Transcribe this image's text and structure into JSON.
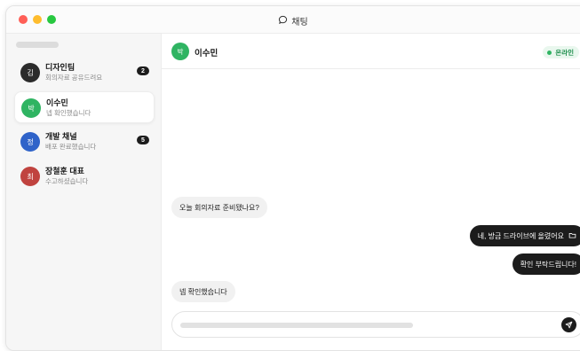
{
  "window": {
    "title": "채팅",
    "title_icon": "chat-bubble-icon"
  },
  "sidebar": {
    "conversations": [
      {
        "avatar": "김",
        "name": "디자인팀",
        "preview": "회의자료 공유드려요",
        "unread": "2",
        "avatar_color": "#2b2b2b",
        "active": false
      },
      {
        "avatar": "박",
        "name": "이수민",
        "preview": "넵 확인했습니다",
        "unread": "",
        "avatar_color": "#2fb462",
        "active": true
      },
      {
        "avatar": "정",
        "name": "개발 채널",
        "preview": "배포 완료했습니다",
        "unread": "5",
        "avatar_color": "#2f63c9",
        "active": false
      },
      {
        "avatar": "최",
        "name": "장철훈 대표",
        "preview": "수고하셨습니다",
        "unread": "",
        "avatar_color": "#c0433f",
        "active": false
      }
    ]
  },
  "chat": {
    "header": {
      "avatar": "박",
      "name": "이수민",
      "status": "온라인"
    },
    "messages": [
      {
        "direction": "in",
        "text": "오늘 회의자료 준비됐나요?"
      },
      {
        "direction": "out",
        "text": "네, 방금 드라이브에 올렸어요",
        "icon": "folder-icon"
      },
      {
        "direction": "out",
        "text": "확인 부탁드립니다!"
      },
      {
        "direction": "in",
        "text": "넵 확인했습니다"
      }
    ],
    "composer": {
      "send_icon": "send-icon"
    }
  },
  "colors": {
    "accent": "#1c1c1c",
    "online": "#2fb462"
  }
}
